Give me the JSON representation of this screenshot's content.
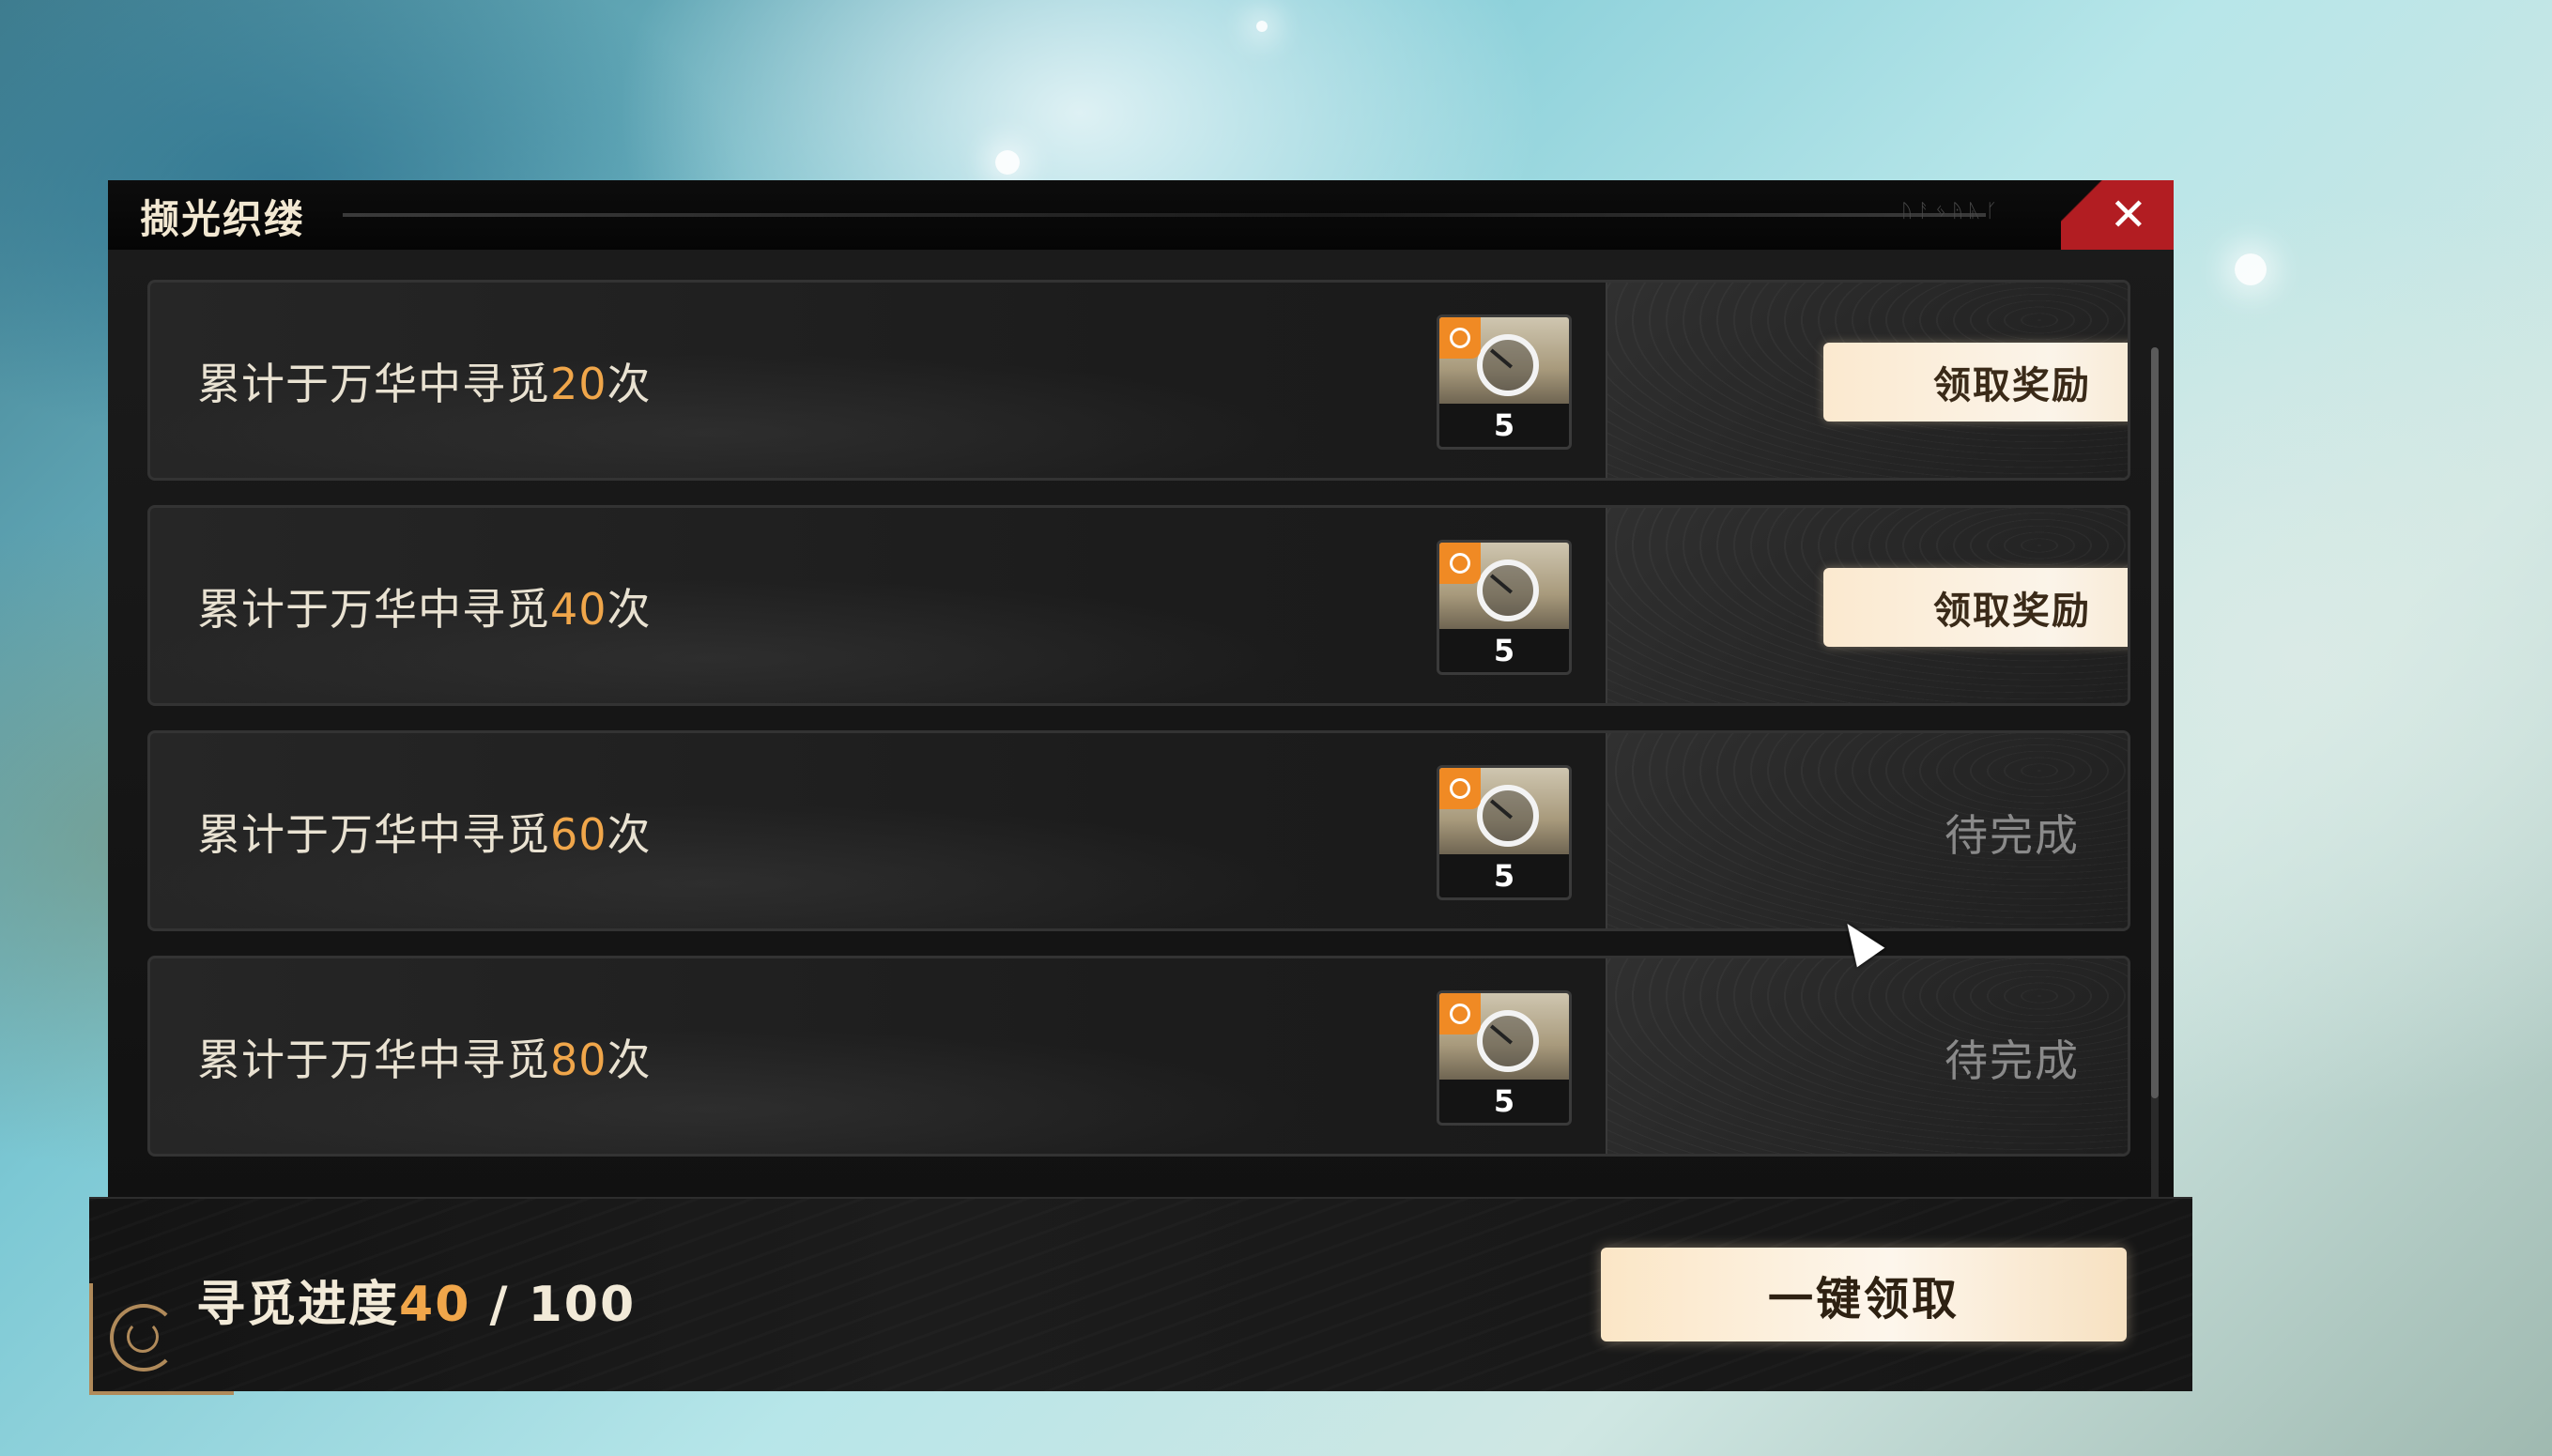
{
  "window": {
    "title": "撷光织缕",
    "close_symbol": "✕"
  },
  "tasks": [
    {
      "prefix": "累计于万华中寻觅",
      "count": "20",
      "suffix": "次",
      "reward_quantity": "5",
      "state": "claim",
      "action_label": "领取奖励"
    },
    {
      "prefix": "累计于万华中寻觅",
      "count": "40",
      "suffix": "次",
      "reward_quantity": "5",
      "state": "claim",
      "action_label": "领取奖励"
    },
    {
      "prefix": "累计于万华中寻觅",
      "count": "60",
      "suffix": "次",
      "reward_quantity": "5",
      "state": "pending",
      "action_label": "待完成"
    },
    {
      "prefix": "累计于万华中寻觅",
      "count": "80",
      "suffix": "次",
      "reward_quantity": "5",
      "state": "pending",
      "action_label": "待完成"
    }
  ],
  "footer": {
    "progress_label": "寻觅进度",
    "progress_current": "40",
    "progress_separator": " / ",
    "progress_total": "100",
    "claim_all_label": "一键领取"
  },
  "colors": {
    "accent": "#f0a64a",
    "close": "#b21d22",
    "button": "#fbe9cf"
  },
  "icons": {
    "reward_item": "silver-ring-icon",
    "reward_badge": "clock-icon",
    "close": "close-icon"
  }
}
